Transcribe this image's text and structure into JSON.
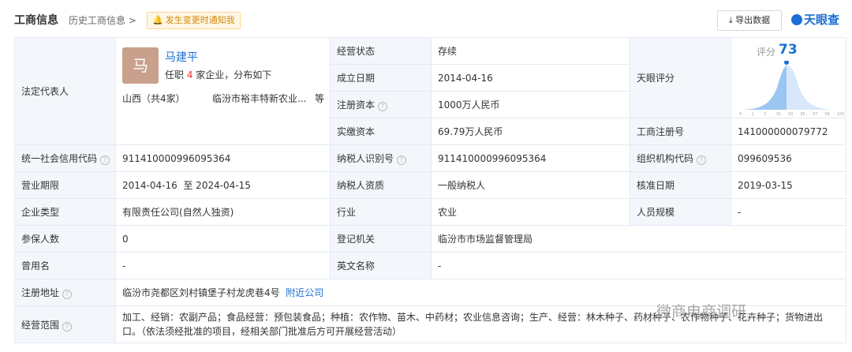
{
  "header": {
    "title": "工商信息",
    "history": "历史工商信息 >",
    "notify": "发生变更时通知我",
    "export": "导出数据",
    "brand": "天眼查"
  },
  "legal": {
    "label": "法定代表人",
    "avatar": "马",
    "name": "马建平",
    "position_pre": "任职 ",
    "count": "4",
    "position_post": " 家企业，分布如下",
    "region": "山西（共4家）",
    "company": "临汾市裕丰特新农业...",
    "more": "等"
  },
  "rows": {
    "status_label": "经营状态",
    "status": "存续",
    "est_label": "成立日期",
    "est": "2014-04-16",
    "reg_cap_label": "注册资本",
    "reg_cap": "1000万人民币",
    "paid_label": "实缴资本",
    "paid": "69.79万人民币",
    "tyscore_label": "天眼评分",
    "score_label": "评分",
    "score": "73",
    "reg_no_label": "工商注册号",
    "reg_no": "141000000079772",
    "credit_label": "统一社会信用代码",
    "credit": "911410000996095364",
    "tax_label": "纳税人识别号",
    "tax": "911410000996095364",
    "org_label": "组织机构代码",
    "org": "099609536",
    "period_label": "营业期限",
    "period": "2014-04-16  至 2024-04-15",
    "taxq_label": "纳税人资质",
    "taxq": "一般纳税人",
    "approve_label": "核准日期",
    "approve": "2019-03-15",
    "type_label": "企业类型",
    "type": "有限责任公司(自然人独资)",
    "industry_label": "行业",
    "industry": "农业",
    "staff_label": "人员规模",
    "staff": "-",
    "insured_label": "参保人数",
    "insured": "0",
    "authority_label": "登记机关",
    "authority": "临汾市市场监督管理局",
    "former_label": "曾用名",
    "former": "-",
    "en_label": "英文名称",
    "en": "-",
    "addr_label": "注册地址",
    "addr": "临汾市尧都区刘村镇堡子村龙虎巷4号",
    "nearby": "附近公司",
    "scope_label": "经营范围",
    "scope1": "加工、经销：农副产品；食品经营：预包装食品；种植：农作物、苗木、中药材；农业信息咨询；生产、经营：林木种子、药材种子、农作物种子、花卉种子；货物进出",
    "scope2": "口。（依法须经批准的项目，经相关部门批准后方可开展经营活动）"
  },
  "chart_data": {
    "type": "area",
    "x_ticks": [
      "0",
      "1",
      "3",
      "15",
      "50",
      "85",
      "97",
      "99",
      "100"
    ],
    "marker": 73
  },
  "watermark": "微商电商调研"
}
